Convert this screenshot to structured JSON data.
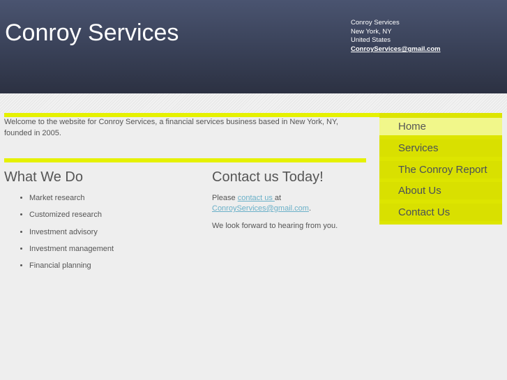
{
  "header": {
    "site_title": "Conroy Services",
    "contact": {
      "line1": "Conroy Services",
      "line2": "New York, NY",
      "line3": "United States",
      "email": "ConroyServices@gmail.com"
    }
  },
  "intro": {
    "text": "Welcome to the website for Conroy Services, a financial services business based in New York, NY, founded in 2005."
  },
  "what_we_do": {
    "title": "What We Do",
    "items": [
      "Market research",
      "Customized research",
      "Investment advisory",
      "Investment management",
      "Financial planning"
    ]
  },
  "contact_section": {
    "title": "Contact us Today!",
    "please": "Please ",
    "link_text": "contact us ",
    "at": "at",
    "email": "ConroyServices@gmail.com",
    "period": ".",
    "closing": "We look forward to hearing from you."
  },
  "nav": {
    "items": [
      "Home",
      "Services",
      "The Conroy Report",
      "About Us",
      "Contact Us"
    ],
    "active": "Home"
  },
  "colors": {
    "accent": "#e5f100",
    "header": "#3a4259",
    "link": "#6ab0c8"
  }
}
